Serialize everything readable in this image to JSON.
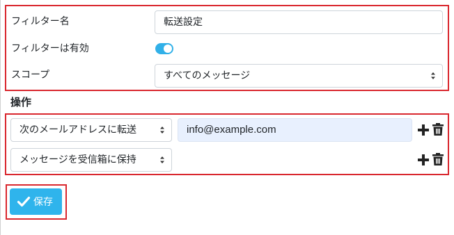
{
  "filter": {
    "name_label": "フィルター名",
    "name_value": "転送設定",
    "enabled_label": "フィルターは有効",
    "enabled": true,
    "scope_label": "スコープ",
    "scope_value": "すべてのメッセージ"
  },
  "actions": {
    "title": "操作",
    "rows": [
      {
        "action": "次のメールアドレスに転送",
        "value": "info@example.com"
      },
      {
        "action": "メッセージを受信箱に保持"
      }
    ]
  },
  "save_label": "保存",
  "colors": {
    "highlight_border": "#d9272e",
    "accent": "#2fb4ec",
    "toggle_on": "#31b0e8",
    "autofill_bg": "#e8f0fe"
  },
  "icons": [
    "plus-icon",
    "trash-icon",
    "check-icon",
    "select-caret-icon"
  ]
}
